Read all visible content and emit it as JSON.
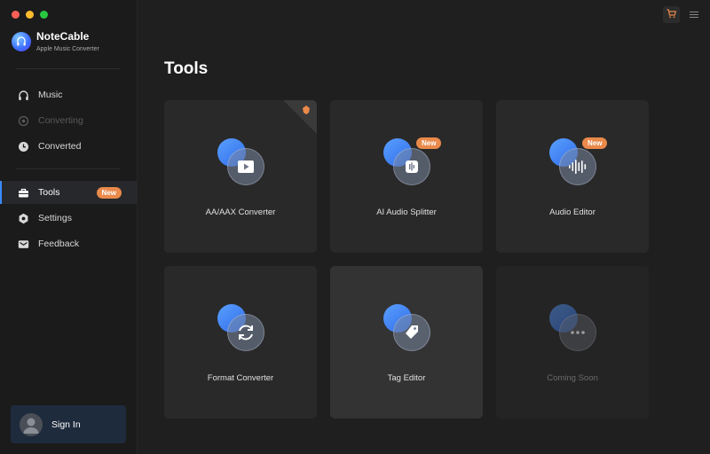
{
  "app": {
    "name": "NoteCable",
    "subtitle": "Apple Music Converter"
  },
  "sidebar": {
    "items": [
      {
        "label": "Music",
        "icon": "headphones-icon",
        "state": "normal"
      },
      {
        "label": "Converting",
        "icon": "converting-icon",
        "state": "disabled"
      },
      {
        "label": "Converted",
        "icon": "clock-icon",
        "state": "normal"
      },
      {
        "label": "Tools",
        "icon": "toolbox-icon",
        "state": "active",
        "badge": "New"
      },
      {
        "label": "Settings",
        "icon": "gear-icon",
        "state": "normal"
      },
      {
        "label": "Feedback",
        "icon": "mail-icon",
        "state": "normal"
      }
    ],
    "signin_label": "Sign In"
  },
  "main": {
    "title": "Tools",
    "tools": [
      {
        "label": "AA/AAX Converter",
        "icon": "play-icon"
      },
      {
        "label": "AI Audio Splitter",
        "icon": "audio-split-icon",
        "badge": "New"
      },
      {
        "label": "Audio Editor",
        "icon": "waveform-icon",
        "badge": "New"
      },
      {
        "label": "Format Converter",
        "icon": "refresh-icon"
      },
      {
        "label": "Tag Editor",
        "icon": "tag-icon"
      },
      {
        "label": "Coming Soon",
        "icon": "more-icon"
      }
    ]
  },
  "colors": {
    "accent": "#3a8bff",
    "badge": "#e9894a",
    "background": "#1f1f1f"
  }
}
